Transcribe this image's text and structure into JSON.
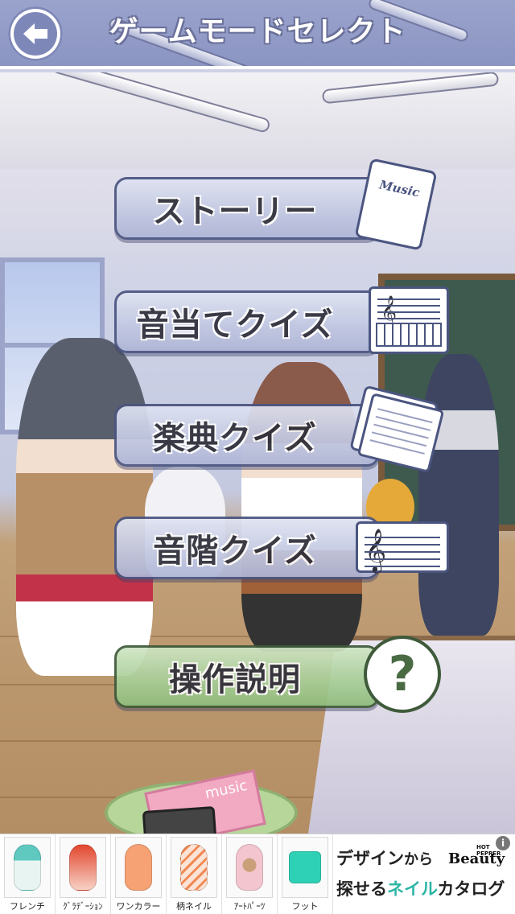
{
  "header": {
    "title": "ゲームモードセレクト",
    "back_icon": "arrow-left-icon"
  },
  "menu": {
    "items": [
      {
        "label": "ストーリー",
        "icon": "music-notebook-icon"
      },
      {
        "label": "音当てクイズ",
        "icon": "staff-keyboard-icon"
      },
      {
        "label": "楽典クイズ",
        "icon": "sheet-music-icon"
      },
      {
        "label": "音階クイズ",
        "icon": "treble-clef-staff-icon"
      },
      {
        "label": "操作説明",
        "icon": "question-mark-icon"
      }
    ],
    "notebook_text": "Music",
    "help_symbol": "?"
  },
  "scene": {
    "book_text": "music"
  },
  "ad": {
    "items": [
      {
        "label": "フレンチ",
        "color": "#e8f4f2",
        "accent": "#5fc9c0"
      },
      {
        "label": "ｸﾞﾗﾃﾞｰｼｮﾝ",
        "color": "#f7d2c6",
        "accent": "#e2462e"
      },
      {
        "label": "ワンカラー",
        "color": "#f6a274",
        "accent": "#ef7d3e"
      },
      {
        "label": "柄ネイル",
        "color": "#fbe3d6",
        "accent": "#f08a54"
      },
      {
        "label": "ｱｰﾄﾊﾟｰﾂ",
        "color": "#f3c6cf",
        "accent": "#c9a07a"
      },
      {
        "label": "フット",
        "color": "#2fd1b6",
        "accent": "#19b39a"
      }
    ],
    "line1_main": "デザイン",
    "line1_small": "から",
    "brand": "Beauty",
    "brand_tag": "HOT PEPPER",
    "line2_a": "探せる",
    "line2_accent": "ネイル",
    "line2_b": "カタログ",
    "info": "i"
  }
}
